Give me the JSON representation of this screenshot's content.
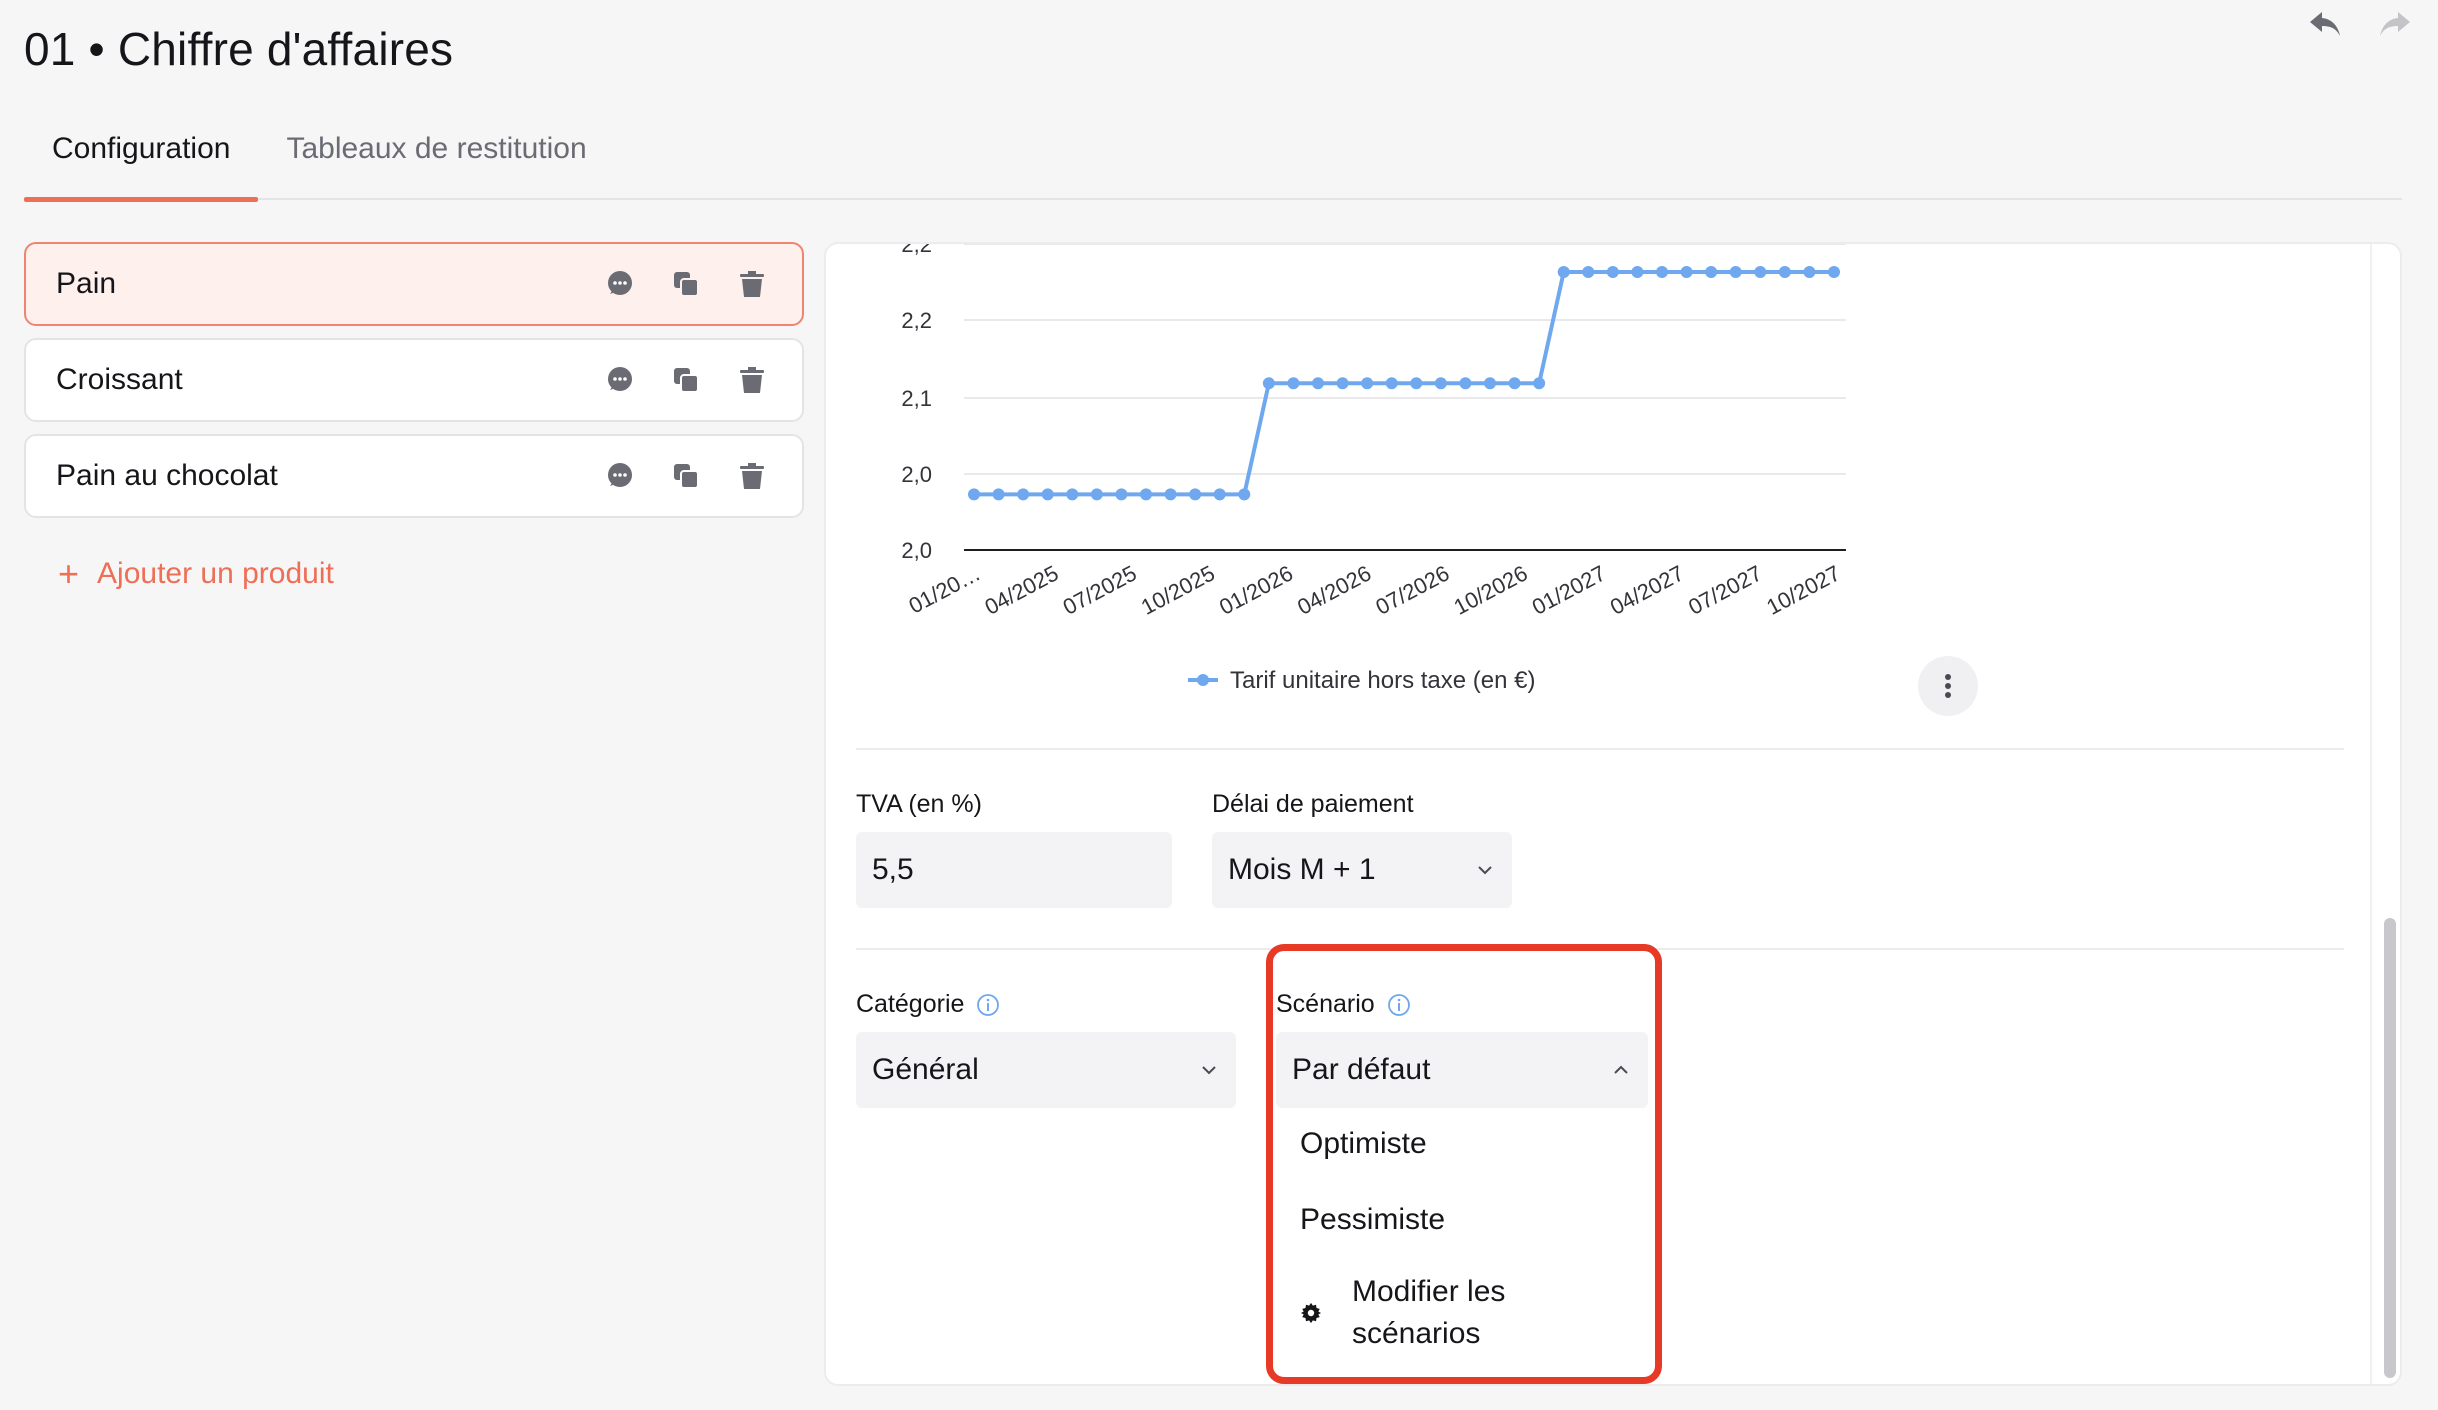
{
  "page": {
    "title": "01 • Chiffre d'affaires"
  },
  "tabs": [
    {
      "label": "Configuration",
      "active": true
    },
    {
      "label": "Tableaux de restitution",
      "active": false
    }
  ],
  "products": [
    {
      "name": "Pain",
      "selected": true
    },
    {
      "name": "Croissant",
      "selected": false
    },
    {
      "name": "Pain au chocolat",
      "selected": false
    }
  ],
  "add_product_label": "Ajouter un produit",
  "icons": {
    "undo": "undo-icon",
    "redo": "redo-icon",
    "comment": "comment-icon",
    "duplicate": "duplicate-icon",
    "delete": "trash-icon",
    "info": "info-icon",
    "gear": "gear-icon",
    "chevron_down": "chevron-down-icon",
    "chevron_up": "chevron-up-icon",
    "more": "more-vertical-icon"
  },
  "colors": {
    "accent": "#ee6e56",
    "line": "#6fa8ee",
    "highlight": "#e63a27"
  },
  "chart_data": {
    "type": "line",
    "y_ticks": [
      "2,2",
      "2,2",
      "2,1",
      "2,0",
      "2,0"
    ],
    "x_ticks": [
      "01/20…",
      "04/2025",
      "07/2025",
      "10/2025",
      "01/2026",
      "04/2026",
      "07/2026",
      "10/2026",
      "01/2027",
      "04/2027",
      "07/2027",
      "10/2027"
    ],
    "ylim": [
      2.0,
      2.2
    ],
    "series": [
      {
        "name": "Tarif unitaire hors taxe (en €)",
        "values": [
          2.04,
          2.04,
          2.04,
          2.04,
          2.04,
          2.04,
          2.04,
          2.04,
          2.04,
          2.04,
          2.04,
          2.04,
          2.12,
          2.12,
          2.12,
          2.12,
          2.12,
          2.12,
          2.12,
          2.12,
          2.12,
          2.12,
          2.12,
          2.12,
          2.2,
          2.2,
          2.2,
          2.2,
          2.2,
          2.2,
          2.2,
          2.2,
          2.2,
          2.2,
          2.2,
          2.2
        ]
      }
    ],
    "legend": "bottom",
    "grid": true
  },
  "tva": {
    "label": "TVA (en %)",
    "value": "5,5"
  },
  "delai": {
    "label": "Délai de paiement",
    "value": "Mois M + 1"
  },
  "categorie": {
    "label": "Catégorie",
    "value": "Général"
  },
  "scenario": {
    "label": "Scénario",
    "value": "Par défaut",
    "options": [
      "Optimiste",
      "Pessimiste"
    ],
    "modify_label_line1": "Modifier les",
    "modify_label_line2": "scénarios"
  }
}
